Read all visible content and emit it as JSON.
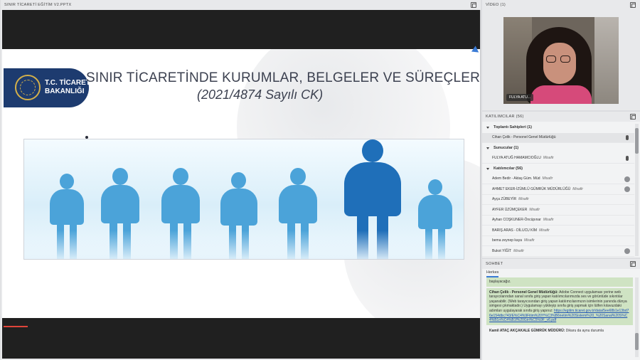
{
  "share": {
    "title": "SINIR TİCARETİ EĞİTİM V2.PPTX",
    "slide": {
      "logo_line1": "T.C. TİCARET",
      "logo_line2": "BAKANLIĞI",
      "title": "SINIR TİCARETİNDE KURUMLAR, BELGELER VE SÜREÇLER",
      "subtitle": "(2021/4874 Sayılı CK)"
    }
  },
  "video": {
    "title": "VİDEO (1)",
    "name_tag": "FULYA ATU..."
  },
  "attendees": {
    "title": "KATILIMCILAR  (56)",
    "groups": [
      {
        "label": "Toplantı Sahipleri (1)"
      },
      {
        "label": "Sunucular (1)"
      },
      {
        "label": "Katılımcılar (56)"
      }
    ],
    "hosts": [
      {
        "name": "Cihan Çelik - Personel Genel Müdürlüğü",
        "role": ""
      }
    ],
    "presenters": [
      {
        "name": "FULYA ATUĞ HAMAMCIOĞLU",
        "role": "Misafir"
      }
    ],
    "participants": [
      {
        "name": "Adem Bedir - Aktaş Güm. Müd",
        "role": "Misafir"
      },
      {
        "name": "AHMET EKER-İZÜMLÜ GÜMRÜK MÜDÜRLÜĞÜ",
        "role": "Misafir"
      },
      {
        "name": "Ayça ZÜBEYİR",
        "role": "Misafir"
      },
      {
        "name": "AYFER ÜZÜMÇEKER",
        "role": "Misafir"
      },
      {
        "name": "Ayhan COŞKUNER-Öncüpınar",
        "role": "Misafir"
      },
      {
        "name": "BARIŞ ARAS - DİLUCU KİM",
        "role": "Misafir"
      },
      {
        "name": "bema zeynep kaya",
        "role": "Misafir"
      },
      {
        "name": "Bukot YİĞİT",
        "role": "Misafir"
      }
    ]
  },
  "chat": {
    "title": "SOHBET",
    "tab": "Herkes",
    "messages": [
      {
        "sender": "",
        "text": "başlayacağız."
      },
      {
        "sender": "Cihan Çelik - Personel Genel Müdürlüğü:",
        "text": "Adobe Connect uygulaması yerine web tarayıcılarından sanal sınıfa giriş yapan katılımcılarımızda ses ve görüntüde sıkıntılar yaşanabilir. (Web tarayıcısından giriş yapan katılımcılarımızın isimlerinin yanında dünya simgesi çıkmaktadır.) Uygulamayı yükleyip sınıfa giriş yapmak için lütfen kılavuzdaki adımları uygulayarak sınıfa giriş yapınız:",
        "link": "https://egitim.ticaret.gov.tr/data/5ee68b1e13bd76e154dbc743/E%C4%9Fitim%20Y%C3%B6netim%20Sistemi%20_%20Sanal%20S%C4%B1n%C4%B1f%20Giri%C5%9F_v6.pdf"
      },
      {
        "sender": "Kamil ATAÇ AKÇAKALE GÜMRÜK MÜDÜRÜ:",
        "text": "Dikaru da aynu durumla"
      }
    ]
  }
}
